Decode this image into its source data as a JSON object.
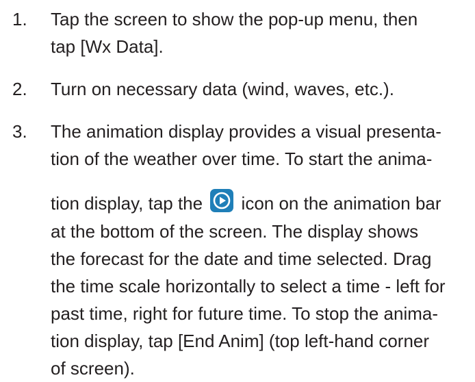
{
  "steps": [
    {
      "number": "1.",
      "lines": [
        "Tap the screen to show the pop-up menu, then",
        "tap [Wx Data]."
      ]
    },
    {
      "number": "2.",
      "lines": [
        "Turn on necessary data (wind, waves, etc.)."
      ]
    },
    {
      "number": "3.",
      "lines": [
        "The animation display provides a visual presenta-",
        "tion of the weather over time. To start the anima-",
        "tion display, tap the ",
        " icon on the animation bar",
        "at the bottom of the screen. The display shows",
        "the forecast for the date and time selected. Drag",
        "the time scale horizontally to select a time - left for",
        "past time, right for future time. To stop the anima-",
        "tion display, tap [End Anim] (top left-hand corner",
        "of screen)."
      ]
    }
  ],
  "icons": {
    "play": "play-circle-icon",
    "play_color": "#1f7fb8"
  }
}
